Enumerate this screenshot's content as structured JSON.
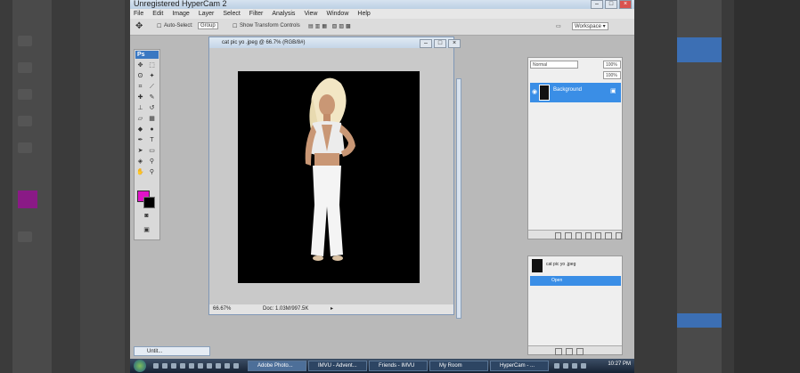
{
  "app": {
    "title": "Unregistered HyperCam 2",
    "menu": [
      "File",
      "Edit",
      "Image",
      "Layer",
      "Select",
      "Filter",
      "Analysis",
      "View",
      "Window",
      "Help"
    ],
    "window_controls": [
      "–",
      "□",
      "×"
    ]
  },
  "options_bar": {
    "auto_select_label": "Auto-Select:",
    "auto_select_value": "Group",
    "transform_controls_label": "Show Transform Controls",
    "workspace_label": "Workspace ▾"
  },
  "toolbox": {
    "badge": "Ps",
    "foreground_color": "#e013c8",
    "background_color": "#000000"
  },
  "document": {
    "title": "cat pic yo .jpeg @ 66.7% (RGB/8#)",
    "zoom": "66.67%",
    "doc_info": "Doc: 1.03M/997.5K"
  },
  "layers_panel": {
    "blend_mode": "Normal",
    "opacity": "100%",
    "fill": "100%",
    "layer_name": "Background"
  },
  "history_panel": {
    "snapshot_name": "cat pic yo .jpeg",
    "step": "Open"
  },
  "minimized_window": {
    "label": "Untit..."
  },
  "taskbar": {
    "items": [
      "Adobe Photo...",
      "IMVU - Advent...",
      "Friends - IMVU",
      "My Room",
      "HyperCam - ..."
    ],
    "clock": "10:27 PM"
  }
}
